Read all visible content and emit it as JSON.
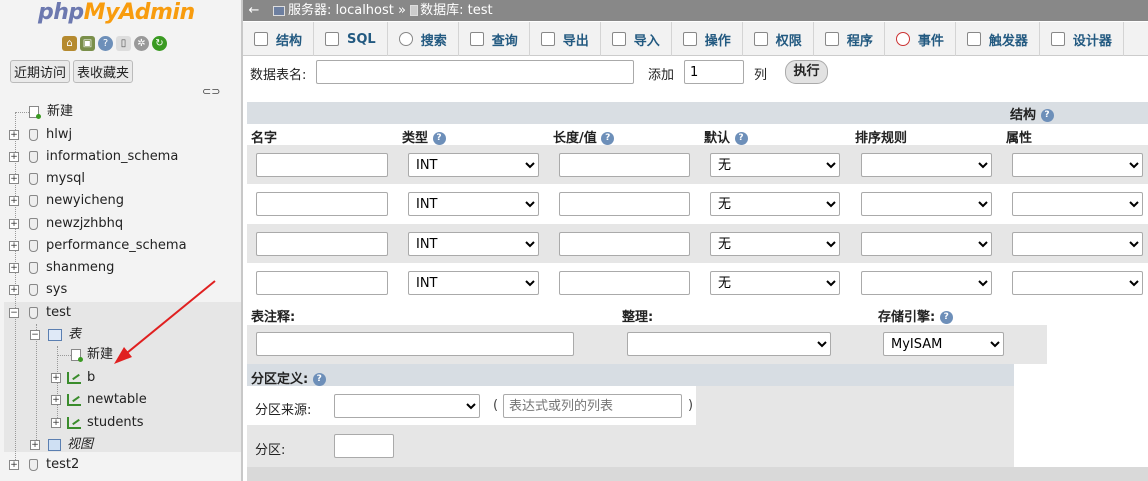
{
  "nav": {
    "logo_php": "php",
    "logo_myadmin": "MyAdmin",
    "tab_recent": "近期访问",
    "tab_favorites": "表收藏夹",
    "new_label": "新建",
    "databases": [
      "hlwj",
      "information_schema",
      "mysql",
      "newyicheng",
      "newzjzhbhq",
      "performance_schema",
      "shanmeng",
      "sys",
      "test"
    ],
    "test_children": {
      "tables_group": "表",
      "new_table": "新建",
      "tables": [
        "b",
        "newtable",
        "students"
      ],
      "views_group": "视图"
    },
    "after_test": "test2",
    "collapse_glyph": "⊖"
  },
  "breadcrumb": {
    "back_glyph": "←",
    "server": "服务器: localhost",
    "separator": "»",
    "database": "数据库: test"
  },
  "tabs": [
    "结构",
    "SQL",
    "搜索",
    "查询",
    "导出",
    "导入",
    "操作",
    "权限",
    "程序",
    "事件",
    "触发器",
    "设计器"
  ],
  "form": {
    "table_name_label": "数据表名:",
    "table_name_value": "",
    "add_label": "添加",
    "add_count": "1",
    "columns_unit": "列",
    "go_button": "执行",
    "structure_heading": "结构",
    "col_headers": {
      "name": "名字",
      "type": "类型",
      "length": "长度/值",
      "default": "默认",
      "collation": "排序规则",
      "attributes": "属性"
    },
    "rows": [
      {
        "name": "",
        "type": "INT",
        "length": "",
        "default": "无",
        "collation": "",
        "attributes": ""
      },
      {
        "name": "",
        "type": "INT",
        "length": "",
        "default": "无",
        "collation": "",
        "attributes": ""
      },
      {
        "name": "",
        "type": "INT",
        "length": "",
        "default": "无",
        "collation": "",
        "attributes": ""
      },
      {
        "name": "",
        "type": "INT",
        "length": "",
        "default": "无",
        "collation": "",
        "attributes": ""
      }
    ],
    "table_comment_label": "表注释:",
    "collation_label": "整理:",
    "engine_label": "存储引擎:",
    "engine_value": "MyISAM",
    "partition_label": "分区定义:",
    "partition_source_label": "分区来源:",
    "partition_expr_placeholder": "表达式或列的列表",
    "partition_count_label": "分区:",
    "paren_open": "(",
    "paren_close": ")"
  },
  "colors": {
    "accent_tab_text": "#235a81",
    "breadcrumb_bg": "#888888",
    "arrow": "#e02020"
  }
}
